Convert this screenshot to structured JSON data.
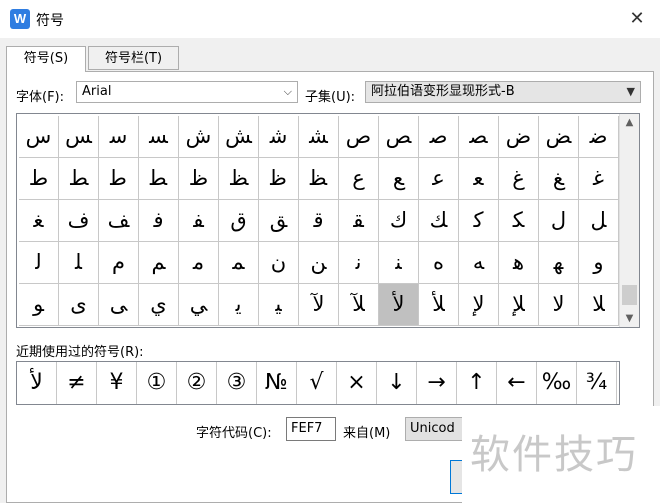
{
  "window": {
    "title": "符号",
    "app_icon_letter": "W",
    "close_glyph": "✕"
  },
  "tabs": [
    {
      "label": "符号(S)"
    },
    {
      "label": "符号栏(T)"
    }
  ],
  "font": {
    "label": "字体(F):",
    "value": "Arial"
  },
  "subset": {
    "label": "子集(U):",
    "value": "阿拉伯语变形显现形式-B"
  },
  "symbols": [
    [
      "ﺱ",
      "ﺲ",
      "ﺳ",
      "ﺴ",
      "ﺵ",
      "ﺶ",
      "ﺷ",
      "ﺸ",
      "ﺹ",
      "ﺺ",
      "ﺻ",
      "ﺼ",
      "ﺽ",
      "ﺾ",
      "ﺿ"
    ],
    [
      "ﻁ",
      "ﻂ",
      "ﻃ",
      "ﻄ",
      "ﻅ",
      "ﻆ",
      "ﻇ",
      "ﻈ",
      "ﻉ",
      "ﻊ",
      "ﻋ",
      "ﻌ",
      "ﻍ",
      "ﻎ",
      "ﻏ"
    ],
    [
      "ﻐ",
      "ﻑ",
      "ﻒ",
      "ﻓ",
      "ﻔ",
      "ﻕ",
      "ﻖ",
      "ﻗ",
      "ﻘ",
      "ﻙ",
      "ﻚ",
      "ﻛ",
      "ﻜ",
      "ﻝ",
      "ﻞ"
    ],
    [
      "ﻟ",
      "ﻠ",
      "ﻡ",
      "ﻢ",
      "ﻣ",
      "ﻤ",
      "ﻥ",
      "ﻦ",
      "ﻧ",
      "ﻨ",
      "ﻩ",
      "ﻪ",
      "ﻫ",
      "ﻬ",
      "ﻭ"
    ],
    [
      "ﻮ",
      "ﻯ",
      "ﻰ",
      "ﻱ",
      "ﻲ",
      "ﻳ",
      "ﻴ",
      "ﻵ",
      "ﻶ",
      "ﻷ",
      "ﻸ",
      "ﻹ",
      "ﻺ",
      "ﻻ",
      "ﻼ"
    ]
  ],
  "selected": {
    "row": 4,
    "col": 9
  },
  "recent": {
    "label": "近期使用过的符号(R):",
    "items": [
      "ﻷ",
      "≠",
      "¥",
      "①",
      "②",
      "③",
      "№",
      "√",
      "×",
      "↓",
      "→",
      "↑",
      "←",
      "‰",
      "¾"
    ]
  },
  "char_code": {
    "label": "字符代码(C):",
    "value": "FEF7"
  },
  "from": {
    "label": "来自(M)",
    "value": "Unicod"
  },
  "watermark": "软件技巧"
}
